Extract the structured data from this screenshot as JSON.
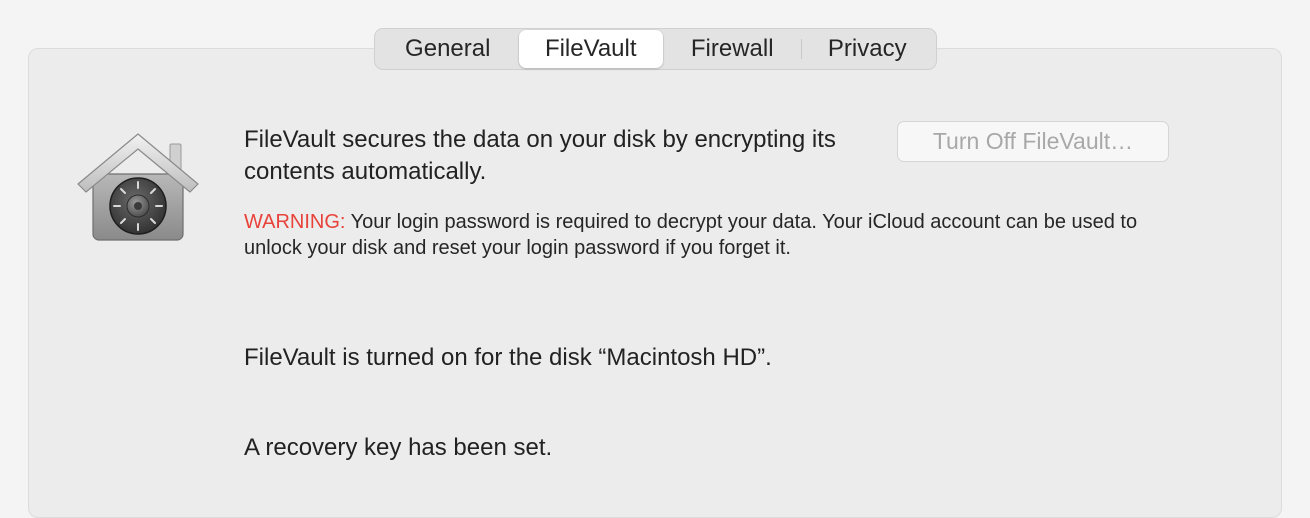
{
  "tabs": [
    {
      "label": "General",
      "active": false
    },
    {
      "label": "FileVault",
      "active": true
    },
    {
      "label": "Firewall",
      "active": false
    },
    {
      "label": "Privacy",
      "active": false
    }
  ],
  "filevault": {
    "icon": "filevault-house-lock-icon",
    "description": "FileVault secures the data on your disk by encrypting its contents automatically.",
    "turn_off_button": "Turn Off FileVault…",
    "warning_label": "WARNING:",
    "warning_text": " Your login password is required to decrypt your data. Your iCloud account can be used to unlock your disk and reset your login password if you forget it.",
    "status": "FileVault is turned on for the disk “Macintosh HD”.",
    "recovery": "A recovery key has been set."
  },
  "colors": {
    "warning": "#e8423a",
    "disabled_text": "#a8a8a8"
  }
}
